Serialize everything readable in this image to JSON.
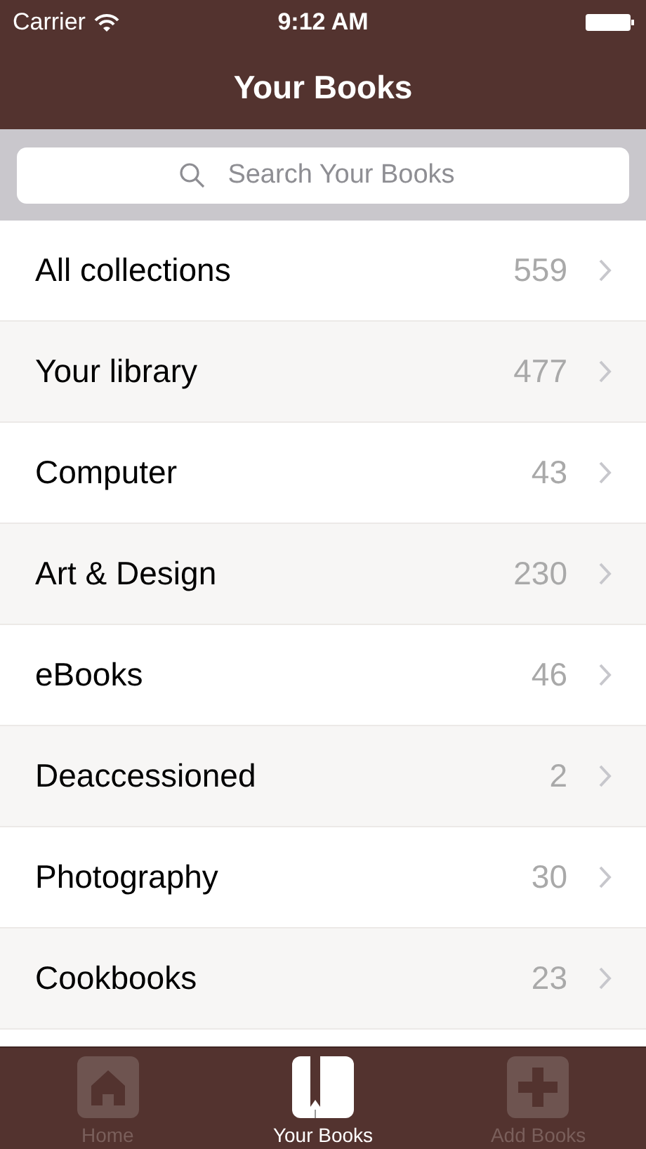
{
  "status_bar": {
    "carrier": "Carrier",
    "time": "9:12 AM"
  },
  "nav_bar": {
    "title": "Your Books"
  },
  "search": {
    "placeholder": "Search Your Books"
  },
  "collections": [
    {
      "name": "All collections",
      "count": "559"
    },
    {
      "name": "Your library",
      "count": "477"
    },
    {
      "name": "Computer",
      "count": "43"
    },
    {
      "name": "Art & Design",
      "count": "230"
    },
    {
      "name": "eBooks",
      "count": "46"
    },
    {
      "name": "Deaccessioned",
      "count": "2"
    },
    {
      "name": "Photography",
      "count": "30"
    },
    {
      "name": "Cookbooks",
      "count": "23"
    }
  ],
  "tabs": [
    {
      "label": "Home",
      "selected": false
    },
    {
      "label": "Your Books",
      "selected": true
    },
    {
      "label": "Add Books",
      "selected": false
    }
  ]
}
